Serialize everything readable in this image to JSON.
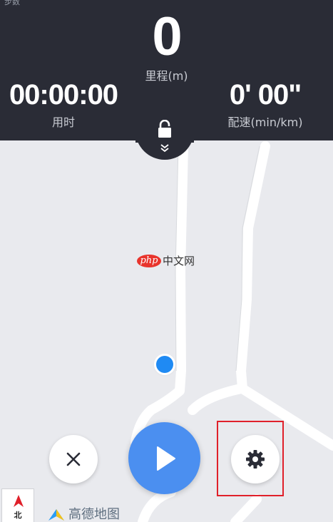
{
  "status_bar": {
    "text": "步数"
  },
  "stats": {
    "distance": {
      "value": "0",
      "label": "里程(m)"
    },
    "time": {
      "value": "00:00:00",
      "label": "用时"
    },
    "pace": {
      "value": "0' 00\"",
      "label": "配速(min/km)"
    }
  },
  "watermark": {
    "badge": "php",
    "text": "中文网"
  },
  "controls": {
    "stop_icon": "close-icon",
    "play_icon": "play-icon",
    "settings_icon": "gear-icon"
  },
  "compass": {
    "label": "北"
  },
  "map_logo": {
    "text": "高德地图"
  },
  "colors": {
    "panel": "#2a2c36",
    "play": "#4b8ff0",
    "location": "#1f8af3",
    "highlight": "#e0202a",
    "map_background": "#e9eaee",
    "road": "#ffffff"
  }
}
